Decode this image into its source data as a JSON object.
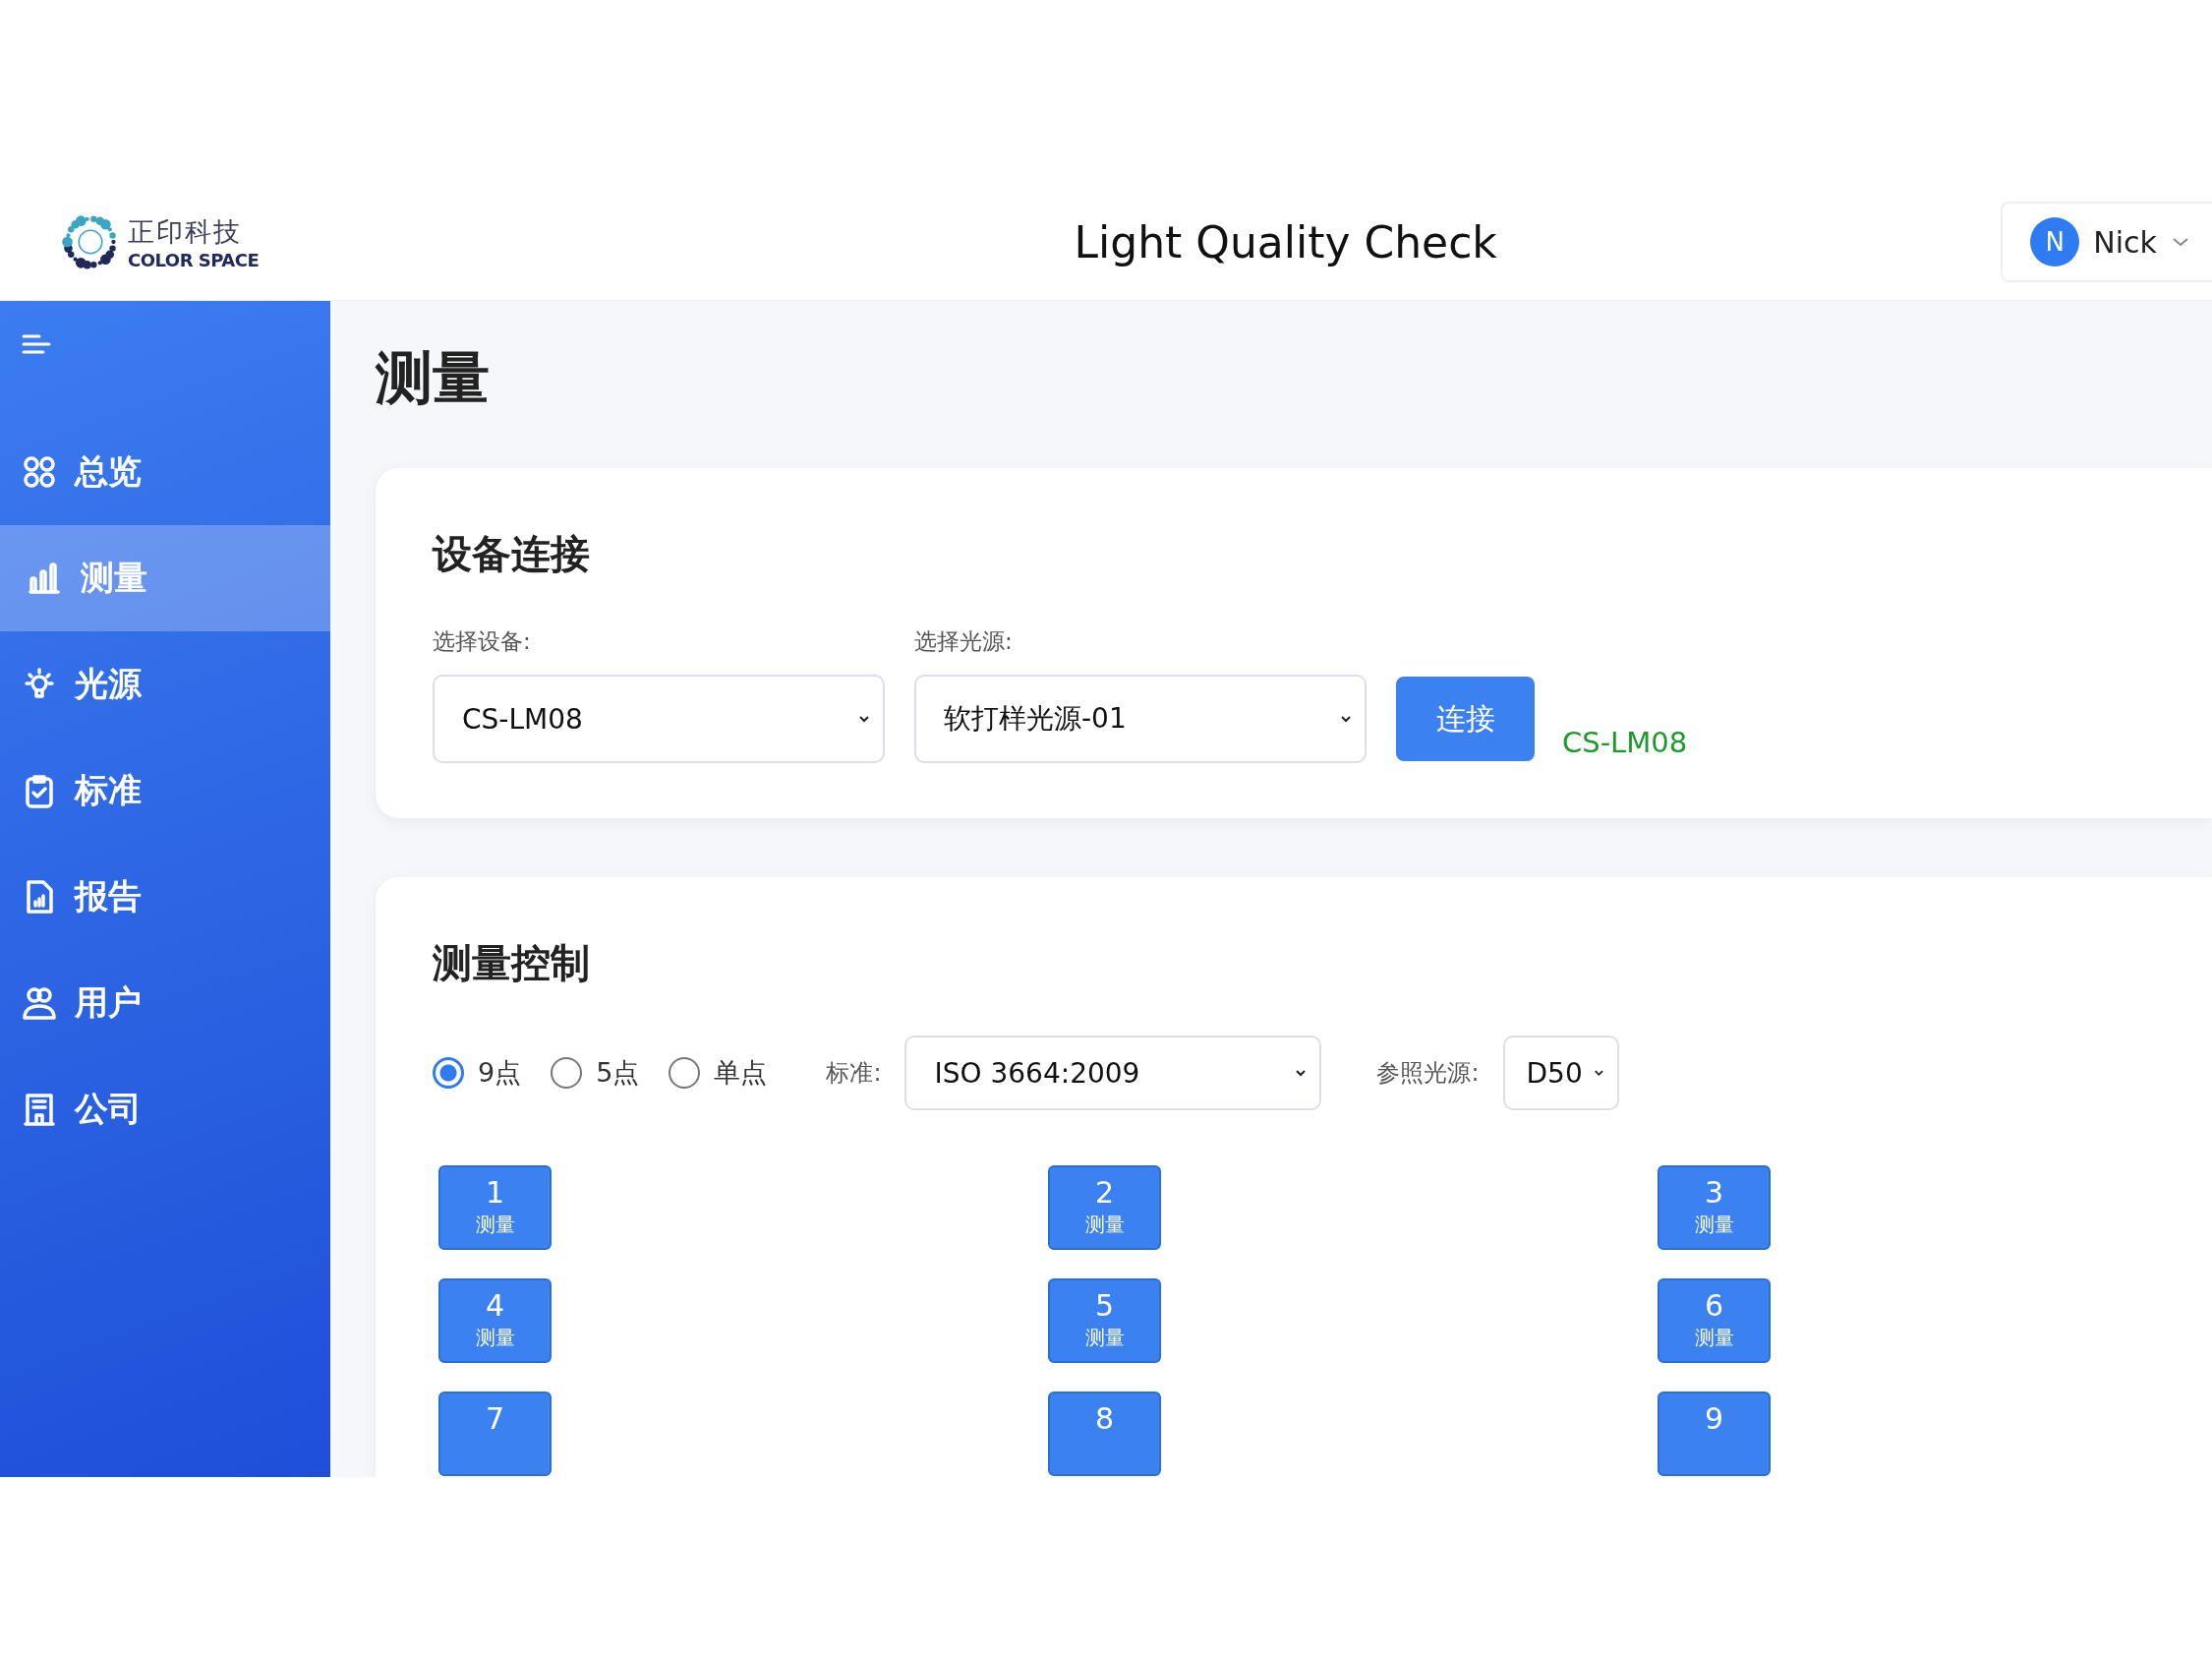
{
  "header": {
    "logo_cn": "正印科技",
    "logo_en": "COLOR SPACE",
    "title": "Light Quality Check",
    "user": {
      "initial": "N",
      "name": "Nick"
    }
  },
  "sidebar": {
    "items": [
      {
        "label": "总览",
        "selected": false
      },
      {
        "label": "测量",
        "selected": true
      },
      {
        "label": "光源",
        "selected": false
      },
      {
        "label": "标准",
        "selected": false
      },
      {
        "label": "报告",
        "selected": false
      },
      {
        "label": "用户",
        "selected": false
      },
      {
        "label": "公司",
        "selected": false
      }
    ]
  },
  "page_title": "测量",
  "device_card": {
    "title": "设备连接",
    "device_label": "选择设备:",
    "device_value": "CS-LM08",
    "light_label": "选择光源:",
    "light_value": "软打样光源-01",
    "connect_button": "连接",
    "status": "CS-LM08"
  },
  "control_card": {
    "title": "测量控制",
    "modes": [
      {
        "label": "9点",
        "selected": true
      },
      {
        "label": "5点",
        "selected": false
      },
      {
        "label": "单点",
        "selected": false
      }
    ],
    "standard_label": "标准:",
    "standard_value": "ISO 3664:2009",
    "illuminant_label": "参照光源:",
    "illuminant_value": "D50",
    "points": [
      {
        "number": "1",
        "label": "测量"
      },
      {
        "number": "2",
        "label": "测量"
      },
      {
        "number": "3",
        "label": "测量"
      },
      {
        "number": "4",
        "label": "测量"
      },
      {
        "number": "5",
        "label": "测量"
      },
      {
        "number": "6",
        "label": "测量"
      },
      {
        "number": "7"
      },
      {
        "number": "8"
      },
      {
        "number": "9"
      }
    ]
  }
}
